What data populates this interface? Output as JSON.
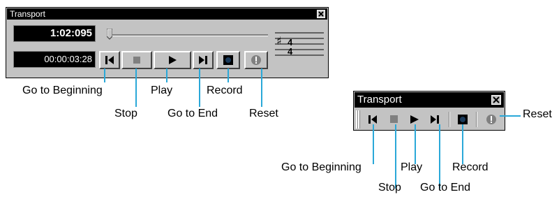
{
  "large": {
    "title": "Transport",
    "position": "1:02:095",
    "time": "00:00:03:28",
    "buttons": [
      {
        "name": "go-to-beginning",
        "icon": "go-to-beginning-icon"
      },
      {
        "name": "stop",
        "icon": "stop-icon"
      },
      {
        "name": "play",
        "icon": "play-icon"
      },
      {
        "name": "go-to-end",
        "icon": "go-to-end-icon"
      },
      {
        "name": "record",
        "icon": "record-icon"
      },
      {
        "name": "reset",
        "icon": "reset-icon"
      }
    ],
    "callouts": {
      "go_to_beginning": "Go to Beginning",
      "stop": "Stop",
      "play": "Play",
      "go_to_end": "Go to End",
      "record": "Record",
      "reset": "Reset"
    }
  },
  "small": {
    "title": "Transport",
    "callouts": {
      "go_to_beginning": "Go to Beginning",
      "stop": "Stop",
      "play": "Play",
      "go_to_end": "Go to End",
      "record": "Record",
      "reset": "Reset"
    }
  },
  "colors": {
    "accent_line": "#2aa8d8",
    "panel": "#c3c3c3",
    "title_bg": "#000000"
  },
  "time_signature": {
    "key": "sharp",
    "top": "4",
    "bottom": "4"
  }
}
